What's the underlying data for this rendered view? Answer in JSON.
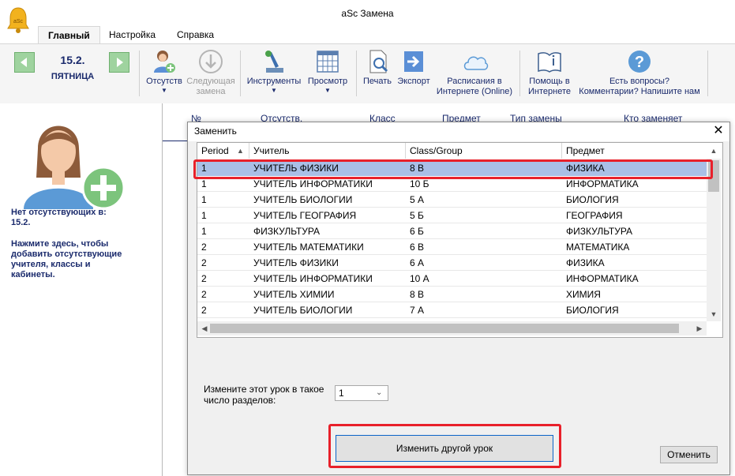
{
  "window": {
    "title": "aSc Замена"
  },
  "tabs": [
    "Главный",
    "Настройка",
    "Справка"
  ],
  "date": {
    "number": "15.2.",
    "weekday": "ПЯТНИЦА"
  },
  "ribbon": {
    "absent": "Отсутств",
    "next_1": "Следующая",
    "next_2": "замена",
    "tools": "Инструменты",
    "view": "Просмотр",
    "print": "Печать",
    "export": "Экспорт",
    "online_1": "Расписания в",
    "online_2": "Интернете (Online)",
    "help_1": "Помощь в",
    "help_2": "Интернете",
    "questions_1": "Есть вопросы?",
    "questions_2": "Комментарии? Напишите нам"
  },
  "left_panel": {
    "no_absent_1": "Нет отсутствующих в:",
    "no_absent_2": "15.2.",
    "hint_1": "Нажмите здесь, чтобы",
    "hint_2": "добавить отсутствующие",
    "hint_3": "учителя, классы и",
    "hint_4": "кабинеты."
  },
  "background_grid": {
    "columns": [
      "№",
      "Отсутств.",
      "Класс",
      "Предмет",
      "Тип замены",
      "Кто заменяет"
    ]
  },
  "dialog": {
    "title": "Заменить",
    "columns": [
      "Period",
      "Учитель",
      "Class/Group",
      "Предмет"
    ],
    "rows": [
      {
        "period": "1",
        "teacher": "УЧИТЕЛЬ ФИЗИКИ",
        "class": "8 В",
        "subject": "ФИЗИКА"
      },
      {
        "period": "1",
        "teacher": "УЧИТЕЛЬ ИНФОРМАТИКИ",
        "class": "10 Б",
        "subject": "ИНФОРМАТИКА"
      },
      {
        "period": "1",
        "teacher": "УЧИТЕЛЬ БИОЛОГИИ",
        "class": "5 А",
        "subject": "БИОЛОГИЯ"
      },
      {
        "period": "1",
        "teacher": "УЧИТЕЛЬ ГЕОГРАФИЯ",
        "class": "5 Б",
        "subject": "ГЕОГРАФИЯ"
      },
      {
        "period": "1",
        "teacher": "ФИЗКУЛЬТУРА",
        "class": "6 Б",
        "subject": "ФИЗКУЛЬТУРА"
      },
      {
        "period": "2",
        "teacher": "УЧИТЕЛЬ МАТЕМАТИКИ",
        "class": "6 В",
        "subject": "МАТЕМАТИКА"
      },
      {
        "period": "2",
        "teacher": "УЧИТЕЛЬ ФИЗИКИ",
        "class": "6 А",
        "subject": "ФИЗИКА"
      },
      {
        "period": "2",
        "teacher": "УЧИТЕЛЬ ИНФОРМАТИКИ",
        "class": "10 А",
        "subject": "ИНФОРМАТИКА"
      },
      {
        "period": "2",
        "teacher": "УЧИТЕЛЬ ХИМИИ",
        "class": "8 В",
        "subject": "ХИМИЯ"
      },
      {
        "period": "2",
        "teacher": "УЧИТЕЛЬ БИОЛОГИИ",
        "class": "7 А",
        "subject": "БИОЛОГИЯ"
      }
    ],
    "split_label_1": "Измените этот урок в такое",
    "split_label_2": "число разделов:",
    "split_value": "1",
    "change_button": "Изменить другой урок",
    "cancel_button": "Отменить"
  }
}
